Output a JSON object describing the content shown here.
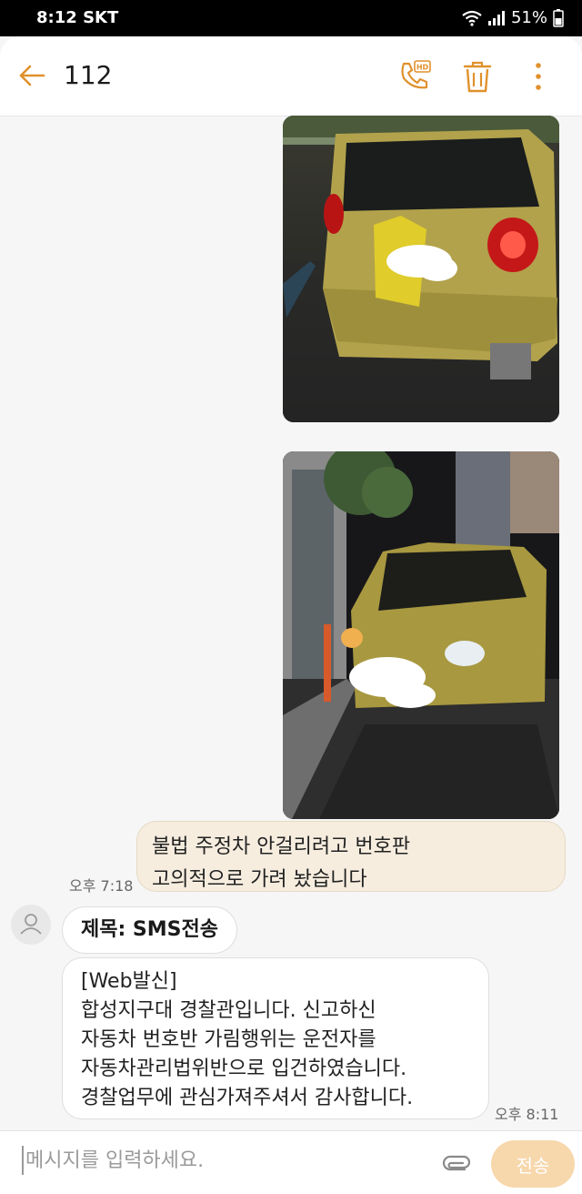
{
  "status": {
    "time": "8:12",
    "carrier": "SKT",
    "battery": "51%"
  },
  "header": {
    "title": "112",
    "icons": [
      "back-arrow-icon",
      "hd-call-icon",
      "trash-icon",
      "more-vertical-icon"
    ]
  },
  "messages": {
    "outgoing": {
      "images": [
        "photo-car-rear",
        "photo-car-front"
      ],
      "lines": [
        "불법 주정차 안걸리려고 번호판",
        "고의적으로 가려 놨습니다"
      ],
      "time": "오후 7:18"
    },
    "incoming": {
      "subject": "제목: SMS전송",
      "lines": [
        "[Web발신]",
        "합성지구대 경찰관입니다. 신고하신",
        "자동차 번호반 가림행위는 운전자를",
        "자동차관리법위반으로 입건하였습니다.",
        "경찰업무에 관심가져주셔서 감사합니다."
      ],
      "time": "오후 8:11"
    }
  },
  "composer": {
    "placeholder": "메시지를 입력하세요.",
    "send_label": "전송"
  },
  "colors": {
    "accent": "#e0912c",
    "outgoing_bubble": "#f6eddf",
    "send_button": "#f7d7ac"
  }
}
